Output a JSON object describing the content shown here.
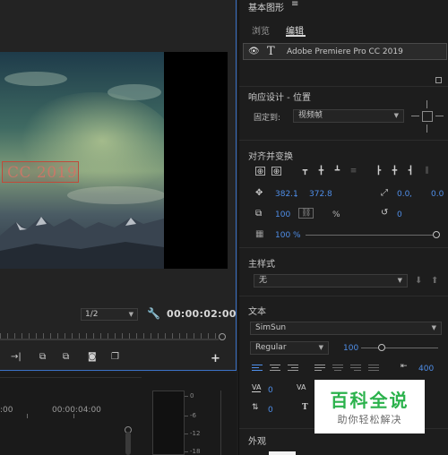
{
  "monitor": {
    "title_overlay": "CC 2019",
    "scale": "1/2",
    "timecode": "00:00:02:00",
    "controls": [
      "mark-out-icon",
      "insert-icon",
      "overwrite-icon",
      "camera-icon",
      "compare-icon"
    ]
  },
  "timeline": {
    "timecodes": [
      ":00",
      "00:00:04:00"
    ],
    "meter_scale": [
      "0",
      "-6",
      "-12",
      "-18"
    ]
  },
  "panel": {
    "title": "基本图形",
    "menu_glyph": "≡",
    "tabs": [
      {
        "label": "浏览",
        "active": false
      },
      {
        "label": "编辑",
        "active": true
      }
    ],
    "layer": {
      "type_glyph": "T",
      "name": "Adobe Premiere Pro CC 2019"
    },
    "responsive": {
      "section": "响应设计 - 位置",
      "pin_label": "固定到:",
      "pin_value": "视频帧"
    },
    "align": {
      "section": "对齐并变换",
      "position_x": "382.1",
      "position_sep": ",",
      "position_y": "372.8",
      "anchor_x": "0.0",
      "anchor_sep": ",",
      "anchor_y": "0.0",
      "scale": "100",
      "scale_unit": "%",
      "rotation": "0",
      "opacity": "100 %",
      "opacity_level": 1.0
    },
    "master_styles": {
      "section": "主样式",
      "value": "无"
    },
    "text": {
      "section": "文本",
      "font": "SimSun",
      "weight": "Regular",
      "size": "100",
      "size_level": 0.27,
      "tracking": "400",
      "kerning_label": "VA",
      "kerning_value": "0",
      "tracking_label": "VA",
      "leading_value": "0",
      "baseline_value": "0",
      "tsume_glyph": "T"
    },
    "appearance": {
      "section": "外观"
    }
  },
  "watermark": {
    "main": "百科全说",
    "sub": "助你轻松解决"
  },
  "colors": {
    "accent_blue": "#4f8ee8",
    "focus_border": "#3c73c8",
    "title_box": "#c04a3a",
    "watermark_green": "#2bb24c"
  }
}
